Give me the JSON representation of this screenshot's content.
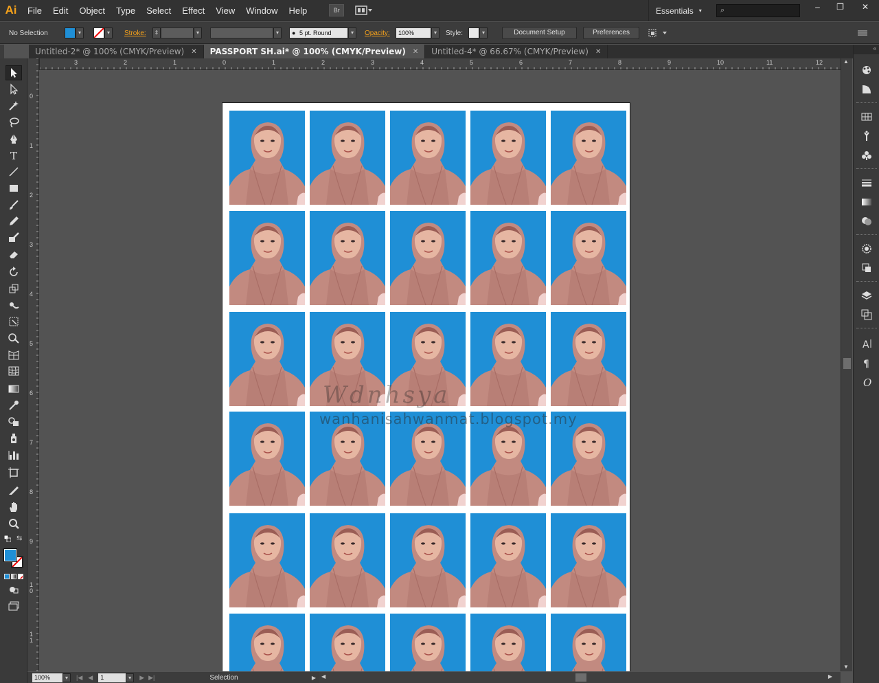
{
  "app": {
    "logo": "Ai",
    "menu": [
      "File",
      "Edit",
      "Object",
      "Type",
      "Select",
      "Effect",
      "View",
      "Window",
      "Help"
    ],
    "bridge_label": "Br",
    "workspace": "Essentials",
    "search_placeholder": "",
    "window_controls": [
      "–",
      "❐",
      "✕"
    ]
  },
  "control_bar": {
    "selection_status": "No Selection",
    "fill_color": "#1f8fd6",
    "stroke_label": "Stroke:",
    "brush_label": "5 pt. Round",
    "opacity_label": "Opacity:",
    "opacity_value": "100%",
    "style_label": "Style:",
    "document_setup": "Document Setup",
    "preferences": "Preferences"
  },
  "tabs": [
    {
      "label": "Untitled-2* @ 100% (CMYK/Preview)",
      "active": false
    },
    {
      "label": "PASSPORT SH.ai* @ 100% (CMYK/Preview)",
      "active": true
    },
    {
      "label": "Untitled-4* @ 66.67% (CMYK/Preview)",
      "active": false
    }
  ],
  "rulers": {
    "horizontal": [
      "3",
      "2",
      "1",
      "0",
      "1",
      "2",
      "3",
      "4",
      "5",
      "6",
      "7",
      "8",
      "9",
      "10",
      "11",
      "12"
    ],
    "vertical": [
      "0",
      "1",
      "2",
      "3",
      "4",
      "5",
      "6",
      "7",
      "8",
      "9",
      "1\n0",
      "1\n1"
    ]
  },
  "tools": [
    "selection-tool-icon",
    "direct-selection-tool-icon",
    "magic-wand-icon",
    "lasso-icon",
    "pen-tool-icon",
    "type-tool-icon",
    "line-tool-icon",
    "rectangle-tool-icon",
    "paintbrush-icon",
    "pencil-icon",
    "blob-brush-icon",
    "eraser-icon",
    "rotate-tool-icon",
    "scale-tool-icon",
    "warp-tool-icon",
    "free-transform-icon",
    "shape-builder-icon",
    "perspective-grid-icon",
    "mesh-tool-icon",
    "gradient-tool-icon",
    "eyedropper-icon",
    "blend-tool-icon",
    "symbol-sprayer-icon",
    "column-graph-icon",
    "artboard-tool-icon",
    "slice-tool-icon",
    "hand-tool-icon",
    "zoom-tool-icon"
  ],
  "artboard": {
    "photo_rows": 6,
    "photo_cols": 5,
    "watermark_signature": "Wdnhsya",
    "watermark_url": "wanhanisahwanmat.blogspot.my"
  },
  "status_bar": {
    "zoom": "100%",
    "artboard_number": "1",
    "current_tool": "Selection"
  }
}
